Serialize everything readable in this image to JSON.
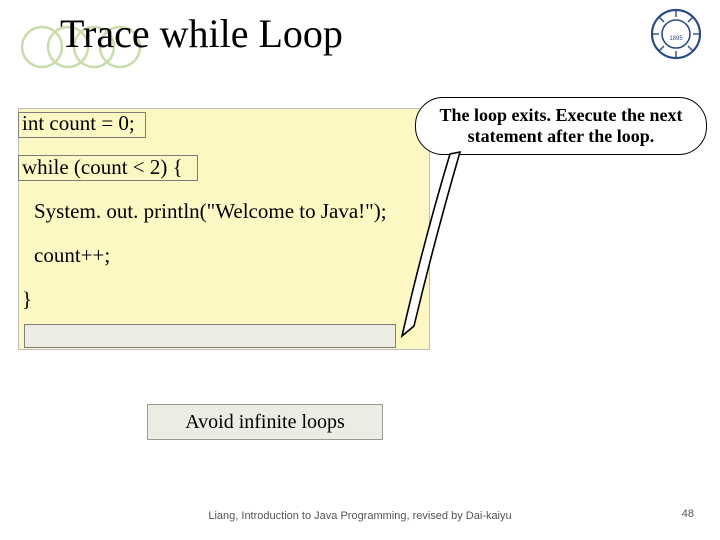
{
  "title": "Trace while Loop",
  "code": {
    "l1": "int count = 0;",
    "l2": "while (count < 2) {",
    "l3": "System. out. println(\"Welcome to Java!\");",
    "l4": "count++;",
    "l5": "}"
  },
  "callout": {
    "line1": "The loop exits. Execute the next",
    "line2": "statement after the loop."
  },
  "tip": "Avoid infinite loops",
  "footer": "Liang, Introduction to Java Programming, revised by Dai-kaiyu",
  "page": "48",
  "colors": {
    "codebox_bg": "#fdf7c4",
    "tip_bg": "#ecece2"
  }
}
